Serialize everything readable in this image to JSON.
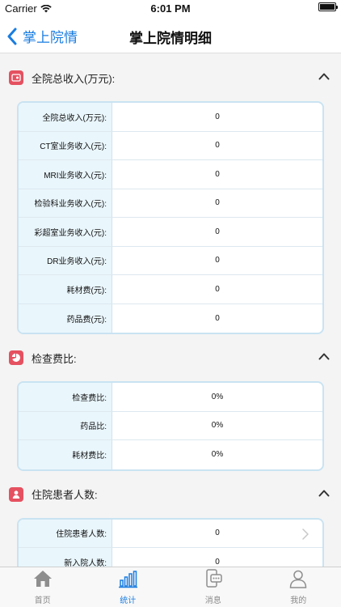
{
  "status": {
    "carrier": "Carrier",
    "time": "6:01 PM"
  },
  "nav": {
    "back_label": "掌上院情",
    "title": "掌上院情明细"
  },
  "sections": [
    {
      "title": "全院总收入(万元):",
      "rows": [
        {
          "label": "全院总收入(万元):",
          "value": "0"
        },
        {
          "label": "CT室业务收入(元):",
          "value": "0"
        },
        {
          "label": "MRI业务收入(元):",
          "value": "0"
        },
        {
          "label": "检验科业务收入(元):",
          "value": "0"
        },
        {
          "label": "彩超室业务收入(元):",
          "value": "0"
        },
        {
          "label": "DR业务收入(元):",
          "value": "0"
        },
        {
          "label": "耗材费(元):",
          "value": "0"
        },
        {
          "label": "药品费(元):",
          "value": "0"
        }
      ]
    },
    {
      "title": "检查费比:",
      "rows": [
        {
          "label": "检查费比:",
          "value": "0%"
        },
        {
          "label": "药品比:",
          "value": "0%"
        },
        {
          "label": "耗材费比:",
          "value": "0%"
        }
      ]
    },
    {
      "title": "住院患者人数:",
      "rows": [
        {
          "label": "住院患者人数:",
          "value": "0"
        },
        {
          "label": "新入院人数:",
          "value": "0"
        }
      ]
    }
  ],
  "tabs": [
    {
      "label": "首页",
      "icon": "home-icon"
    },
    {
      "label": "统计",
      "icon": "bar-chart-icon"
    },
    {
      "label": "消息",
      "icon": "message-icon"
    },
    {
      "label": "我的",
      "icon": "user-icon"
    }
  ],
  "colors": {
    "accent": "#1a7de0",
    "section_icon": "#e55160",
    "table_border": "#c9e3f2",
    "label_bg": "#e9f6fc"
  }
}
